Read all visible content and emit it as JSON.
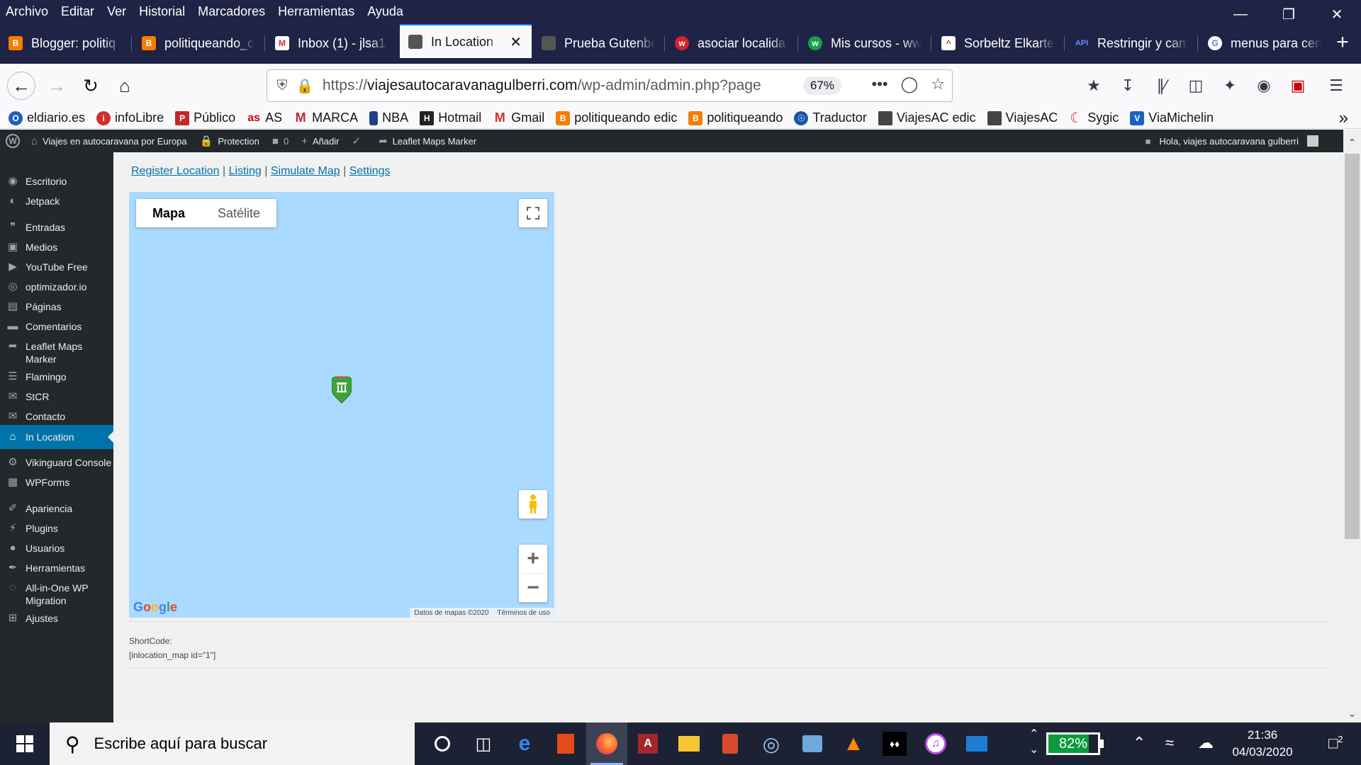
{
  "menubar": {
    "items": [
      "Archivo",
      "Editar",
      "Ver",
      "Historial",
      "Marcadores",
      "Herramientas",
      "Ayuda"
    ]
  },
  "tabs": [
    {
      "label": "Blogger: politiq",
      "favicon": "blogger-icon",
      "color": "#f57d00",
      "glyph": "B"
    },
    {
      "label": "politiqueando_c",
      "favicon": "blogger-icon",
      "color": "#f57d00",
      "glyph": "B"
    },
    {
      "label": "Inbox (1) - jlsa1",
      "favicon": "gmail-icon",
      "color": "#ffffff",
      "glyph": "M"
    },
    {
      "label": "In Location",
      "favicon": "site-icon",
      "color": "#555555",
      "glyph": ""
    },
    {
      "label": "Prueba Gutenbe",
      "favicon": "site-icon",
      "color": "#555555",
      "glyph": ""
    },
    {
      "label": "asociar localida",
      "favicon": "w-red-icon",
      "color": "#d3212d",
      "glyph": "w"
    },
    {
      "label": "Mis cursos - ww",
      "favicon": "w-green-icon",
      "color": "#15a04a",
      "glyph": "w"
    },
    {
      "label": "Sorbeltz Elkarte",
      "favicon": "sorbeltz-icon",
      "color": "#c0392b",
      "glyph": "^"
    },
    {
      "label": "Restringir y cam",
      "favicon": "api-icon",
      "color": "#3b5bdb",
      "glyph": "API"
    },
    {
      "label": "menus para cen",
      "favicon": "google-icon",
      "color": "#ffffff",
      "glyph": "G"
    }
  ],
  "navbar": {
    "url_host": "viajesautocaravanagulberri.com",
    "url_prefix": "https://",
    "url_path": "/wp-admin/admin.php?page=",
    "zoom": "67%"
  },
  "bookmarks": [
    {
      "label": "eldiario.es",
      "icon": "eldiario-icon",
      "color": "#1f5fbf",
      "glyph": "O"
    },
    {
      "label": "infoLibre",
      "icon": "infolibre-icon",
      "color": "#d32f2f",
      "glyph": "i"
    },
    {
      "label": "Público",
      "icon": "publico-icon",
      "color": "#c62828",
      "glyph": "P"
    },
    {
      "label": "AS",
      "icon": "as-icon",
      "color": "#d50000",
      "glyph": "as"
    },
    {
      "label": "MARCA",
      "icon": "marca-icon",
      "color": "#c62828",
      "glyph": "M"
    },
    {
      "label": "NBA",
      "icon": "nba-icon",
      "color": "#1d428a",
      "glyph": "N"
    },
    {
      "label": "Hotmail",
      "icon": "hotmail-icon",
      "color": "#222222",
      "glyph": "H"
    },
    {
      "label": "Gmail",
      "icon": "gmail-icon",
      "color": "#d93025",
      "glyph": "M"
    },
    {
      "label": "politiqueando edic",
      "icon": "blogger-icon",
      "color": "#f57d00",
      "glyph": "B"
    },
    {
      "label": "politiqueando",
      "icon": "blogger-icon",
      "color": "#f57d00",
      "glyph": "B"
    },
    {
      "label": "Traductor",
      "icon": "globe-icon",
      "color": "#1a56a8",
      "glyph": "⊕"
    },
    {
      "label": "ViajesAC edic",
      "icon": "site-icon",
      "color": "#444444",
      "glyph": ""
    },
    {
      "label": "ViajesAC",
      "icon": "site-icon",
      "color": "#444444",
      "glyph": ""
    },
    {
      "label": "Sygic",
      "icon": "sygic-icon",
      "color": "#e02020",
      "glyph": "C"
    },
    {
      "label": "ViaMichelin",
      "icon": "michelin-icon",
      "color": "#1565c0",
      "glyph": "V"
    }
  ],
  "adminbar": {
    "site_name": "Viajes en autocaravana por Europa",
    "protection": "Protection",
    "comments_count": "0",
    "add_new": "Añadir",
    "plugin": "Leaflet Maps Marker",
    "greeting": "Hola, viajes autocaravana gulberri"
  },
  "sidebar": {
    "items": [
      {
        "label": "Escritorio",
        "icon": "dashboard-icon",
        "glyph": "◉"
      },
      {
        "label": "Jetpack",
        "icon": "jetpack-icon",
        "glyph": "◐"
      },
      {
        "label": "Entradas",
        "icon": "pin-icon",
        "glyph": "✎"
      },
      {
        "label": "Medios",
        "icon": "media-icon",
        "glyph": "▣"
      },
      {
        "label": "YouTube Free",
        "icon": "youtube-icon",
        "glyph": "▶"
      },
      {
        "label": "optimizador.io",
        "icon": "optimizer-icon",
        "glyph": "◎"
      },
      {
        "label": "Páginas",
        "icon": "pages-icon",
        "glyph": "▤"
      },
      {
        "label": "Comentarios",
        "icon": "comments-icon",
        "glyph": "▬"
      },
      {
        "label": "Leaflet Maps Marker",
        "icon": "leaflet-icon",
        "glyph": "➶"
      },
      {
        "label": "Flamingo",
        "icon": "flamingo-icon",
        "glyph": "☰"
      },
      {
        "label": "StCR",
        "icon": "mail-icon",
        "glyph": "✉"
      },
      {
        "label": "Contacto",
        "icon": "mail-icon",
        "glyph": "✉"
      },
      {
        "label": "In Location",
        "icon": "inlocation-icon",
        "glyph": "⌂"
      },
      {
        "label": "Vikinguard Console",
        "icon": "gear-icon",
        "glyph": "⚙"
      },
      {
        "label": "WPForms",
        "icon": "forms-icon",
        "glyph": "▦"
      },
      {
        "label": "Apariencia",
        "icon": "brush-icon",
        "glyph": "✐"
      },
      {
        "label": "Plugins",
        "icon": "plugin-icon",
        "glyph": "⚡"
      },
      {
        "label": "Usuarios",
        "icon": "users-icon",
        "glyph": "●"
      },
      {
        "label": "Herramientas",
        "icon": "tools-icon",
        "glyph": "✒"
      },
      {
        "label": "All-in-One WP Migration",
        "icon": "migration-icon",
        "glyph": "◌"
      },
      {
        "label": "Ajustes",
        "icon": "settings-icon",
        "glyph": "⊞"
      }
    ],
    "current": "In Location"
  },
  "content": {
    "links": [
      "Register Location",
      "Listing",
      "Simulate Map",
      "Settings"
    ],
    "map": {
      "type_map": "Mapa",
      "type_satellite": "Satélite",
      "selected_type": "Mapa",
      "attribution": "Datos de mapas ©2020",
      "terms": "Términos de uso",
      "logo": "Google"
    },
    "shortcode_label": "ShortCode:",
    "shortcode_value": "[inlocation_map id=\"1\"]"
  },
  "taskbar": {
    "search_placeholder": "Escribe aquí para buscar",
    "battery": "82%",
    "battery_level": 0.82,
    "time": "21:36",
    "date": "04/03/2020",
    "notifications": "2"
  },
  "colors": {
    "firefox_dark": "#1f2345",
    "wp_admin_dark": "#23282d",
    "wp_blue": "#0073aa",
    "map_water": "#aadaff"
  }
}
